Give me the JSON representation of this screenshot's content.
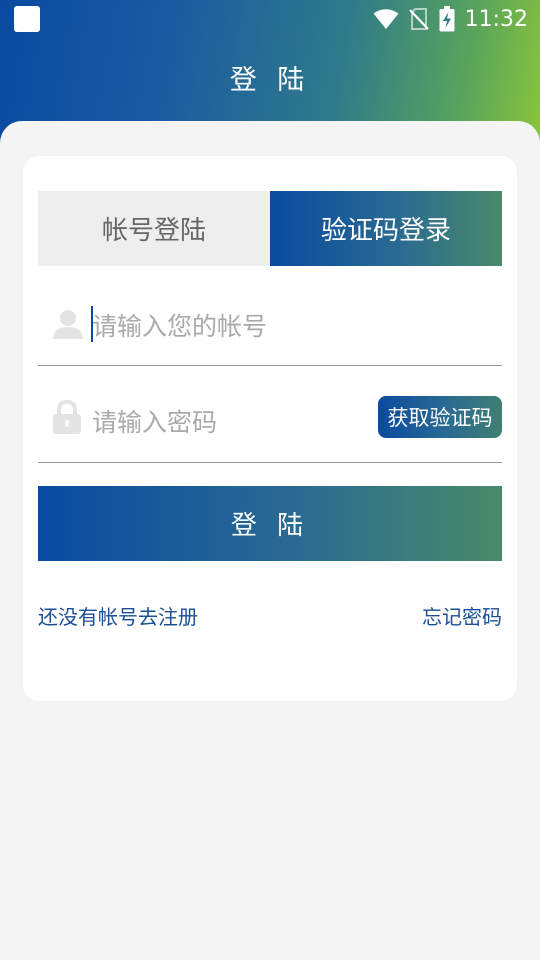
{
  "status_bar": {
    "time": "11:32"
  },
  "header": {
    "title": "登 陆"
  },
  "tabs": [
    {
      "label": "帐号登陆",
      "selected": false
    },
    {
      "label": "验证码登录",
      "selected": true
    }
  ],
  "form": {
    "account_placeholder": "请输入您的帐号",
    "account_value": "",
    "password_placeholder": "请输入密码",
    "password_value": "",
    "get_code_label": "获取验证码",
    "login_label": "登 陆"
  },
  "links": {
    "register": "还没有帐号去注册",
    "forgot": "忘记密码"
  },
  "colors": {
    "primary": "#0a4aa0",
    "accent_end": "#4a8a6a",
    "link": "#1a4f96"
  }
}
